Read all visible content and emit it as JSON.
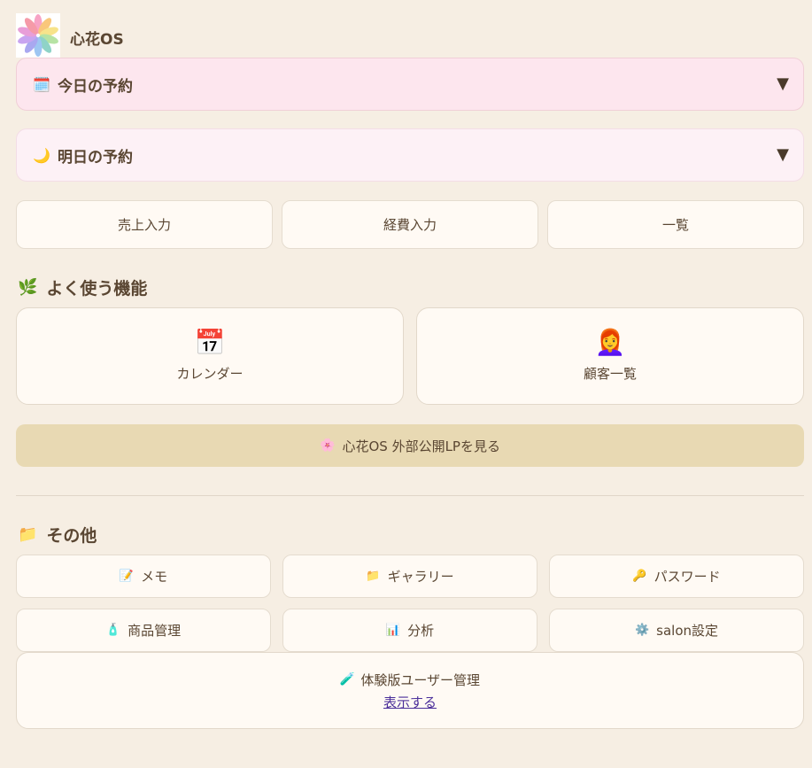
{
  "header": {
    "app_name": "心花OS"
  },
  "accordions": [
    {
      "icon": "calendar-icon",
      "emoji": "🗓️",
      "label": "今日の予約",
      "toggle": "▼"
    },
    {
      "icon": "moon-icon",
      "emoji": "🌙",
      "label": "明日の予約",
      "toggle": "▼"
    }
  ],
  "quick_actions": [
    "売上入力",
    "経費入力",
    "一覧"
  ],
  "frequent": {
    "emoji": "🌿",
    "title": "よく使う機能",
    "cards": [
      {
        "icon": "calendar-icon",
        "emoji": "📅",
        "label": "カレンダー"
      },
      {
        "icon": "customer-icon",
        "emoji": "👩‍🦰",
        "label": "顧客一覧"
      }
    ]
  },
  "lp_button": {
    "emoji": "🌸",
    "label": "心花OS 外部公開LPを見る"
  },
  "others": {
    "emoji": "📁",
    "title": "その他",
    "items": [
      {
        "icon": "memo-icon",
        "emoji": "📝",
        "label": "メモ"
      },
      {
        "icon": "folder-icon",
        "emoji": "📁",
        "label": "ギャラリー"
      },
      {
        "icon": "key-icon",
        "emoji": "🔑",
        "label": "パスワード"
      },
      {
        "icon": "bottle-icon",
        "emoji": "🧴",
        "label": "商品管理"
      },
      {
        "icon": "bar-chart-icon",
        "emoji": "📊",
        "label": "分析"
      },
      {
        "icon": "gear-icon",
        "emoji": "⚙️",
        "label": "salon設定"
      }
    ]
  },
  "trial": {
    "emoji": "🧪",
    "label": "体験版ユーザー管理",
    "link": "表示する"
  },
  "colors": {
    "background": "#f6eee3",
    "today": "#fde6ee",
    "tomorrow": "#fdf1f6",
    "lp": "#e8d9b3",
    "text": "#5a4632"
  }
}
